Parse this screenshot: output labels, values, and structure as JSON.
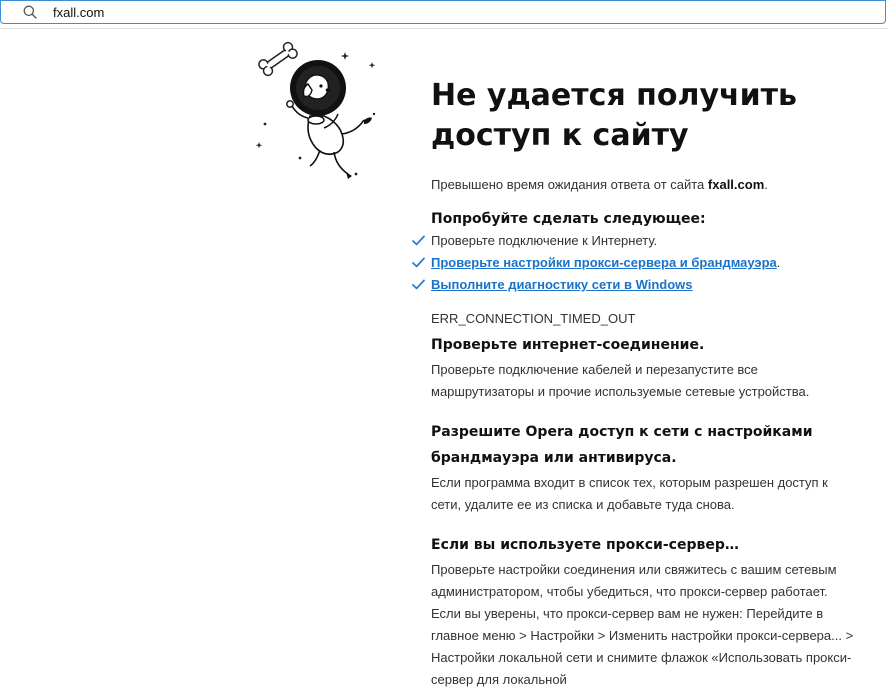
{
  "address_bar": {
    "value": "fxall.com"
  },
  "main": {
    "title": "Не удается получить доступ к сайту",
    "timeout": {
      "prefix": "Превышено время ожидания ответа от сайта ",
      "host": "fxall.com",
      "suffix": "."
    },
    "try_heading": "Попробуйте сделать следующее:",
    "suggestions": [
      {
        "text": "Проверьте подключение к Интернету.",
        "link": false
      },
      {
        "text": "Проверьте настройки прокси-сервера и брандмауэра",
        "link": true,
        "suffix": "."
      },
      {
        "text": "Выполните диагностику сети в Windows",
        "link": true,
        "suffix": ""
      }
    ],
    "error_code": "ERR_CONNECTION_TIMED_OUT",
    "blocks": [
      {
        "heading": "Проверьте интернет-соединение.",
        "body": "Проверьте подключение кабелей и перезапустите все маршрутизаторы и прочие используемые сетевые устройства."
      },
      {
        "heading": "Разрешите Opera доступ к сети с настройками брандмауэра или антивируса.",
        "body": "Если программа входит в список тех, которым разрешен доступ к сети, удалите ее из списка и добавьте туда снова."
      },
      {
        "heading": "Если вы используете прокси-сервер…",
        "body": "Проверьте настройки соединения или свяжитесь с вашим сетевым администратором, чтобы убедиться, что прокси-сервер работает. Если вы уверены, что прокси-сервер вам не нужен: Перейдите в главное меню > Настройки > Изменить настройки прокси-сервера... > Настройки локальной сети и снимите флажок «Использовать прокси-сервер для локальной"
      }
    ]
  },
  "icons": {
    "search": "search-icon",
    "check": "check-icon",
    "illustration": "astronaut-dog-illustration"
  },
  "colors": {
    "address_focus": "#3a8fd8",
    "link": "#1a73c9",
    "check": "#2b7fd0"
  }
}
